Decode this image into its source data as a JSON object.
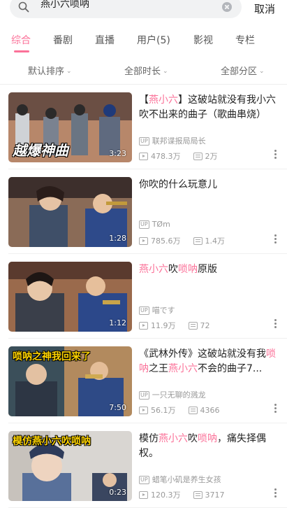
{
  "search": {
    "query": "燕小六唢呐",
    "cancel_label": "取消"
  },
  "tabs": [
    {
      "label": "综合",
      "active": true
    },
    {
      "label": "番剧",
      "active": false
    },
    {
      "label": "直播",
      "active": false
    },
    {
      "label": "用户(5)",
      "active": false
    },
    {
      "label": "影视",
      "active": false
    },
    {
      "label": "专栏",
      "active": false
    }
  ],
  "filters": [
    {
      "label": "默认排序"
    },
    {
      "label": "全部时长"
    },
    {
      "label": "全部分区"
    }
  ],
  "colors": {
    "accent": "#fb7299"
  },
  "results": [
    {
      "title_parts": [
        {
          "text": "【",
          "hl": false
        },
        {
          "text": "燕小六",
          "hl": true
        },
        {
          "text": "】这破站就没有我小六吹不出来的曲子（歌曲串烧）",
          "hl": false
        }
      ],
      "duration": "3:23",
      "up_badge": "UP",
      "uploader": "联邦谍报局局长",
      "views": "478.3万",
      "danmaku": "2万",
      "thumb_overlay": "越爆神曲"
    },
    {
      "title_parts": [
        {
          "text": "你吹的什么玩意儿",
          "hl": false
        }
      ],
      "duration": "1:28",
      "up_badge": "UP",
      "uploader": "TØm",
      "views": "785.6万",
      "danmaku": "1.4万",
      "thumb_overlay": ""
    },
    {
      "title_parts": [
        {
          "text": "燕小六",
          "hl": true
        },
        {
          "text": "吹",
          "hl": false
        },
        {
          "text": "唢呐",
          "hl": true
        },
        {
          "text": "原版",
          "hl": false
        }
      ],
      "duration": "1:12",
      "up_badge": "UP",
      "uploader": "喵です",
      "views": "11.9万",
      "danmaku": "72",
      "thumb_overlay": ""
    },
    {
      "title_parts": [
        {
          "text": "《武林外传》这破站就没有我",
          "hl": false
        },
        {
          "text": "唢呐",
          "hl": true
        },
        {
          "text": "之王",
          "hl": false
        },
        {
          "text": "燕小六",
          "hl": true
        },
        {
          "text": "不会的曲子7...",
          "hl": false
        }
      ],
      "duration": "7:50",
      "up_badge": "UP",
      "uploader": "一只无聊的溅龙",
      "views": "56.1万",
      "danmaku": "4366",
      "thumb_overlay": "唢呐之神我回来了"
    },
    {
      "title_parts": [
        {
          "text": "模仿",
          "hl": false
        },
        {
          "text": "燕小六",
          "hl": true
        },
        {
          "text": "吹",
          "hl": false
        },
        {
          "text": "唢呐",
          "hl": true
        },
        {
          "text": "，痛失择偶权。",
          "hl": false
        }
      ],
      "duration": "0:23",
      "up_badge": "UP",
      "uploader": "蜡笔小矶是养生女孩",
      "views": "120.3万",
      "danmaku": "3717",
      "thumb_overlay": "模仿燕小六吹唢呐"
    }
  ]
}
